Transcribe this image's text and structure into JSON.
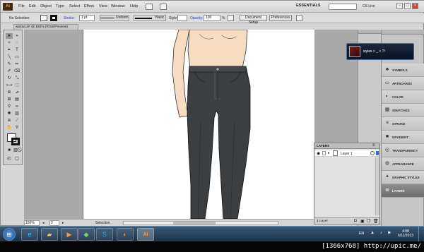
{
  "menubar": {
    "app_logo": "Ai",
    "items": [
      "File",
      "Edit",
      "Object",
      "Type",
      "Select",
      "Effect",
      "View",
      "Window",
      "Help"
    ],
    "workspace": "ESSENTIALS",
    "cs_live": "CS Live",
    "window_controls": [
      "−",
      "□",
      "×"
    ]
  },
  "controlbar": {
    "selection": "No Selection",
    "stroke_label": "Stroke:",
    "stroke_weight": "1 pt",
    "uniform": "Uniform",
    "basic": "Basic",
    "style_label": "Style:",
    "opacity_label": "Opacity:",
    "opacity_value": "100",
    "percent": "%",
    "document_setup": "Document Setup",
    "preferences": "Preferences"
  },
  "document": {
    "tab_title": "wazaa.ai* @ 150% (RGB/Preview)"
  },
  "statusbar": {
    "zoom": "150%",
    "page": "2",
    "mode": "Selection"
  },
  "panels": {
    "items": [
      {
        "label": "SYMBOLS",
        "icon": "symbols-icon",
        "glyph": "♣"
      },
      {
        "label": "ARTBOARDS",
        "icon": "artboards-icon",
        "glyph": "▭"
      },
      {
        "label": "COLOR",
        "icon": "color-icon",
        "glyph": "◐"
      },
      {
        "label": "SWATCHES",
        "icon": "swatches-icon",
        "glyph": "▦"
      },
      {
        "label": "STROKE",
        "icon": "stroke-icon",
        "glyph": "≡"
      },
      {
        "label": "GRADIENT",
        "icon": "gradient-icon",
        "glyph": "■"
      },
      {
        "label": "TRANSPARENCY",
        "icon": "transparency-icon",
        "glyph": "◎"
      },
      {
        "label": "APPEARANCE",
        "icon": "appearance-icon",
        "glyph": "◍"
      },
      {
        "label": "GRAPHIC STYLES",
        "icon": "graphic-styles-icon",
        "glyph": "✦"
      },
      {
        "label": "LAYERS",
        "icon": "layers-icon",
        "glyph": "≣"
      }
    ]
  },
  "layers_panel": {
    "tab": "LAYERS",
    "layer_name": "Layer 1",
    "footer": "1 Layer"
  },
  "notification": {
    "text": "wyias > _ < ?!"
  },
  "taskbar": {
    "lang": "EN",
    "time": "4:08",
    "date": "6/11/2013",
    "apps": [
      "windows-start",
      "ie",
      "explorer",
      "media-player",
      "skype",
      "firefox",
      "illustrator"
    ]
  },
  "watermark": "[1366x768] http://upic.me/",
  "colors": {
    "pants": "#3c3f42",
    "skin": "#f7dcc1",
    "panel_bg": "#c6c6c6"
  }
}
